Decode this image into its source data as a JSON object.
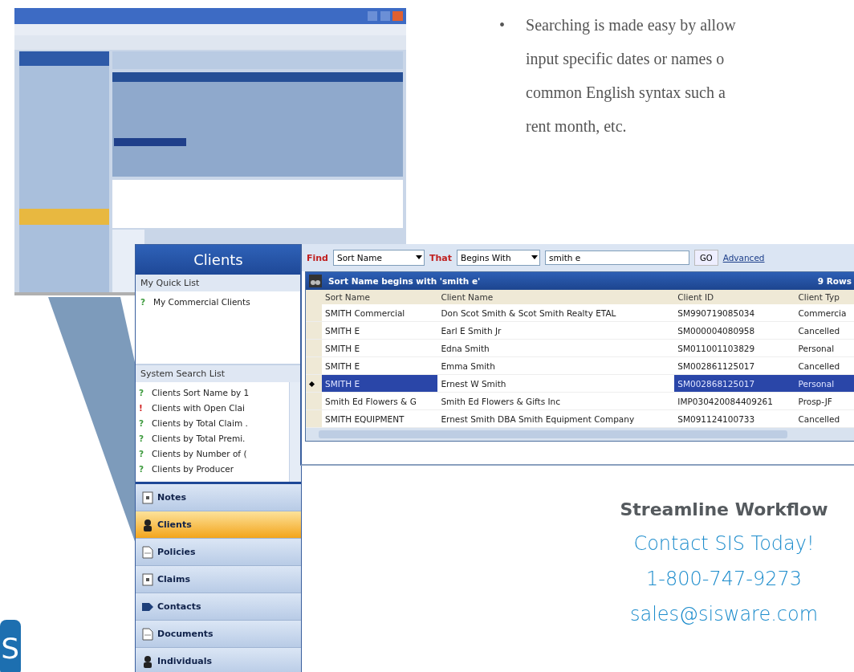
{
  "bullet": {
    "mark": "•",
    "lines": [
      "Searching is made easy by allow",
      "input specific dates or names o",
      "common English syntax such a",
      "rent month, etc."
    ]
  },
  "sidebar": {
    "title": "Clients",
    "quick_list": {
      "heading": "My Quick List",
      "items": [
        {
          "icon": "?",
          "kind": "query",
          "label": "My Commercial Clients"
        }
      ]
    },
    "search_list": {
      "heading": "System Search List",
      "items": [
        {
          "icon": "?",
          "kind": "query",
          "label": "Clients Sort Name by 1"
        },
        {
          "icon": "!",
          "kind": "alert",
          "label": "Clients with Open Clai"
        },
        {
          "icon": "?",
          "kind": "query",
          "label": "Clients by Total Claim ."
        },
        {
          "icon": "?",
          "kind": "query",
          "label": "Clients by Total Premi."
        },
        {
          "icon": "?",
          "kind": "query",
          "label": "Clients by Number of ("
        },
        {
          "icon": "?",
          "kind": "query",
          "label": "Clients by Producer"
        }
      ]
    },
    "nav": [
      {
        "label": "Notes",
        "kind": "note",
        "selected": false
      },
      {
        "label": "Clients",
        "kind": "person",
        "selected": true
      },
      {
        "label": "Policies",
        "kind": "document",
        "selected": false
      },
      {
        "label": "Claims",
        "kind": "note",
        "selected": false
      },
      {
        "label": "Contacts",
        "kind": "contact",
        "selected": false
      },
      {
        "label": "Documents",
        "kind": "document",
        "selected": false
      },
      {
        "label": "Individuals",
        "kind": "person",
        "selected": false
      }
    ]
  },
  "find_bar": {
    "find_label": "Find",
    "field": "Sort Name",
    "that_label": "That",
    "operator": "Begins With",
    "value": "smith e",
    "go": "GO",
    "advanced": "Advanced"
  },
  "grid": {
    "title": "Sort Name begins with 'smith e'",
    "count": "9 Rows",
    "columns": [
      "Sort Name",
      "Client Name",
      "Client ID",
      "Client Typ"
    ],
    "rows": [
      {
        "selected": false,
        "cells": [
          "SMITH Commercial",
          "Don Scot Smith & Scot Smith Realty ETAL",
          "SM990719085034",
          "Commercia"
        ]
      },
      {
        "selected": false,
        "cells": [
          "SMITH E",
          "Earl E Smith Jr",
          "SM000004080958",
          "Cancelled"
        ]
      },
      {
        "selected": false,
        "cells": [
          "SMITH E",
          "Edna Smith",
          "SM011001103829",
          "Personal"
        ]
      },
      {
        "selected": false,
        "cells": [
          "SMITH E",
          "Emma Smith",
          "SM002861125017",
          "Cancelled"
        ]
      },
      {
        "selected": true,
        "cells": [
          "SMITH E",
          "Ernest W Smith",
          "SM002868125017",
          "Personal"
        ]
      },
      {
        "selected": false,
        "cells": [
          "Smith Ed Flowers & G",
          "Smith Ed Flowers & Gifts Inc",
          "IMP030420084409261",
          "Prosp-JF"
        ]
      },
      {
        "selected": false,
        "cells": [
          "SMITH EQUIPMENT",
          "Ernest Smith DBA Smith Equipment Company",
          "SM091124100733",
          "Cancelled"
        ]
      }
    ]
  },
  "promo": {
    "heading": "Streamline Workflow",
    "cta": "Contact SIS Today!",
    "phone": "1-800-747-9273",
    "email": "sales@sisware.com"
  },
  "logo": "S"
}
